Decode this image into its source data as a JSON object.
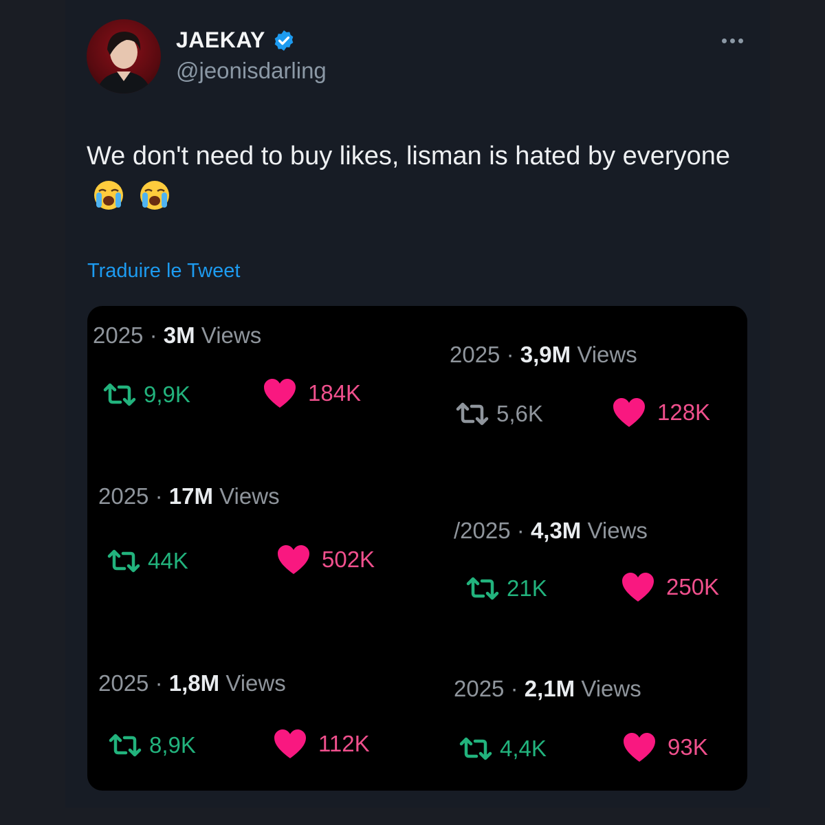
{
  "author": {
    "name": "JAEKAY",
    "handle": "@jeonisdarling"
  },
  "tweet": {
    "text": "We don't need to buy likes, lisman is hated by everyone",
    "emoji": [
      "loudly-crying-face",
      "loudly-crying-face"
    ],
    "translate_label": "Traduire le Tweet"
  },
  "colors": {
    "accent": "#1d9bf0",
    "retweet_green": "#22b37d",
    "retweet_gray": "#8f959c",
    "like_pink": "#f91880"
  },
  "stats": [
    {
      "year": "2025",
      "sep": "·",
      "views": "3M",
      "views_label": "Views",
      "retweets": "9,9K",
      "likes": "184K",
      "retweet_active": true
    },
    {
      "year": "2025",
      "sep": "·",
      "views": "3,9M",
      "views_label": "Views",
      "retweets": "5,6K",
      "likes": "128K",
      "retweet_active": false
    },
    {
      "year": "2025",
      "sep": "·",
      "views": "17M",
      "views_label": "Views",
      "retweets": "44K",
      "likes": "502K",
      "retweet_active": true
    },
    {
      "year": "/2025",
      "sep": "·",
      "views": "4,3M",
      "views_label": "Views",
      "retweets": "21K",
      "likes": "250K",
      "retweet_active": true
    },
    {
      "year": "2025",
      "sep": "·",
      "views": "1,8M",
      "views_label": "Views",
      "retweets": "8,9K",
      "likes": "112K",
      "retweet_active": true
    },
    {
      "year": "2025",
      "sep": "·",
      "views": "2,1M",
      "views_label": "Views",
      "retweets": "4,4K",
      "likes": "93K",
      "retweet_active": true
    }
  ]
}
